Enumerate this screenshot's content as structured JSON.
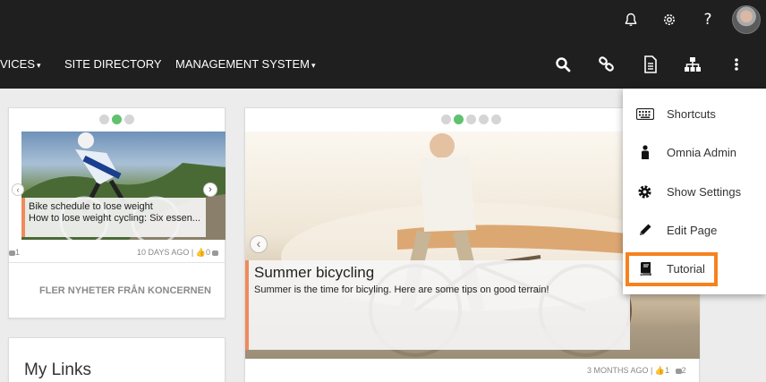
{
  "topbar": {
    "icons": [
      "bell-icon",
      "gear-icon",
      "help-icon",
      "avatar"
    ],
    "help_label": "?"
  },
  "nav": {
    "items": [
      {
        "label": "VICES",
        "caret": "▾"
      },
      {
        "label": "SITE DIRECTORY"
      },
      {
        "label": "MANAGEMENT SYSTEM",
        "caret": "▾"
      }
    ],
    "icons": [
      "search-icon",
      "link-icon",
      "document-icon",
      "sitemap-icon",
      "more-vertical-icon"
    ]
  },
  "news_left": {
    "caption_line1": "Bike schedule to lose weight",
    "caption_line2": "How to lose weight cycling: Six essen...",
    "comments": "1",
    "date": "10 DAYS AGO",
    "separator": "|",
    "likes": "0",
    "footer_link": "FLER NYHETER FRÅN KONCERNEN",
    "dots_total": 3,
    "dots_active": 2
  },
  "news_main": {
    "title": "Summer bicycling",
    "summary": "Summer is the time for bicyling. Here are some tips on good terrain!",
    "date": "3 MONTHS AGO",
    "separator": "|",
    "likes": "1",
    "comments": "2",
    "dots_total": 5,
    "dots_active": 2
  },
  "my_links": {
    "title": "My Links"
  },
  "menu": {
    "items": [
      {
        "label": "Shortcuts",
        "icon": "keyboard-icon"
      },
      {
        "label": "Omnia Admin",
        "icon": "person-icon"
      },
      {
        "label": "Show Settings",
        "icon": "gear-icon"
      },
      {
        "label": "Edit Page",
        "icon": "pencil-icon"
      },
      {
        "label": "Tutorial",
        "icon": "book-icon"
      }
    ],
    "highlighted": "Tutorial",
    "highlight_color": "#f6821f"
  },
  "colors": {
    "bar_bg": "#1f1f1f",
    "accent_green": "#5fc26c",
    "caption_accent": "#f08a5d"
  }
}
